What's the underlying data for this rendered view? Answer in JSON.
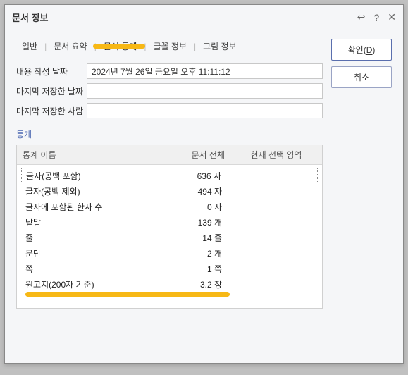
{
  "dialog": {
    "title": "문서 정보"
  },
  "tabs": {
    "general": "일반",
    "summary": "문서 요약",
    "stats": "문서 통계",
    "font": "글꼴 정보",
    "image": "그림 정보"
  },
  "fields": {
    "created_label": "내용 작성 날짜",
    "created_value": "2024년 7월 26일 금요일 오후 11:11:12",
    "saved_date_label": "마지막 저장한 날짜",
    "saved_date_value": "",
    "saved_by_label": "마지막 저장한 사람",
    "saved_by_value": ""
  },
  "stats": {
    "section_label": "통계",
    "header_name": "통계 이름",
    "header_doc": "문서 전체",
    "header_sel": "현재 선택 영역",
    "rows": [
      {
        "name": "글자(공백 포함)",
        "value": "636 자"
      },
      {
        "name": "글자(공백 제외)",
        "value": "494 자"
      },
      {
        "name": "글자에 포함된 한자 수",
        "value": "0 자"
      },
      {
        "name": "낱말",
        "value": "139 개"
      },
      {
        "name": "줄",
        "value": "14 줄"
      },
      {
        "name": "문단",
        "value": "2 개"
      },
      {
        "name": "쪽",
        "value": "1 쪽"
      },
      {
        "name": "원고지(200자 기준)",
        "value": "3.2 장"
      }
    ]
  },
  "buttons": {
    "ok_prefix": "확인(",
    "ok_accel": "D",
    "ok_suffix": ")",
    "cancel": "취소"
  }
}
